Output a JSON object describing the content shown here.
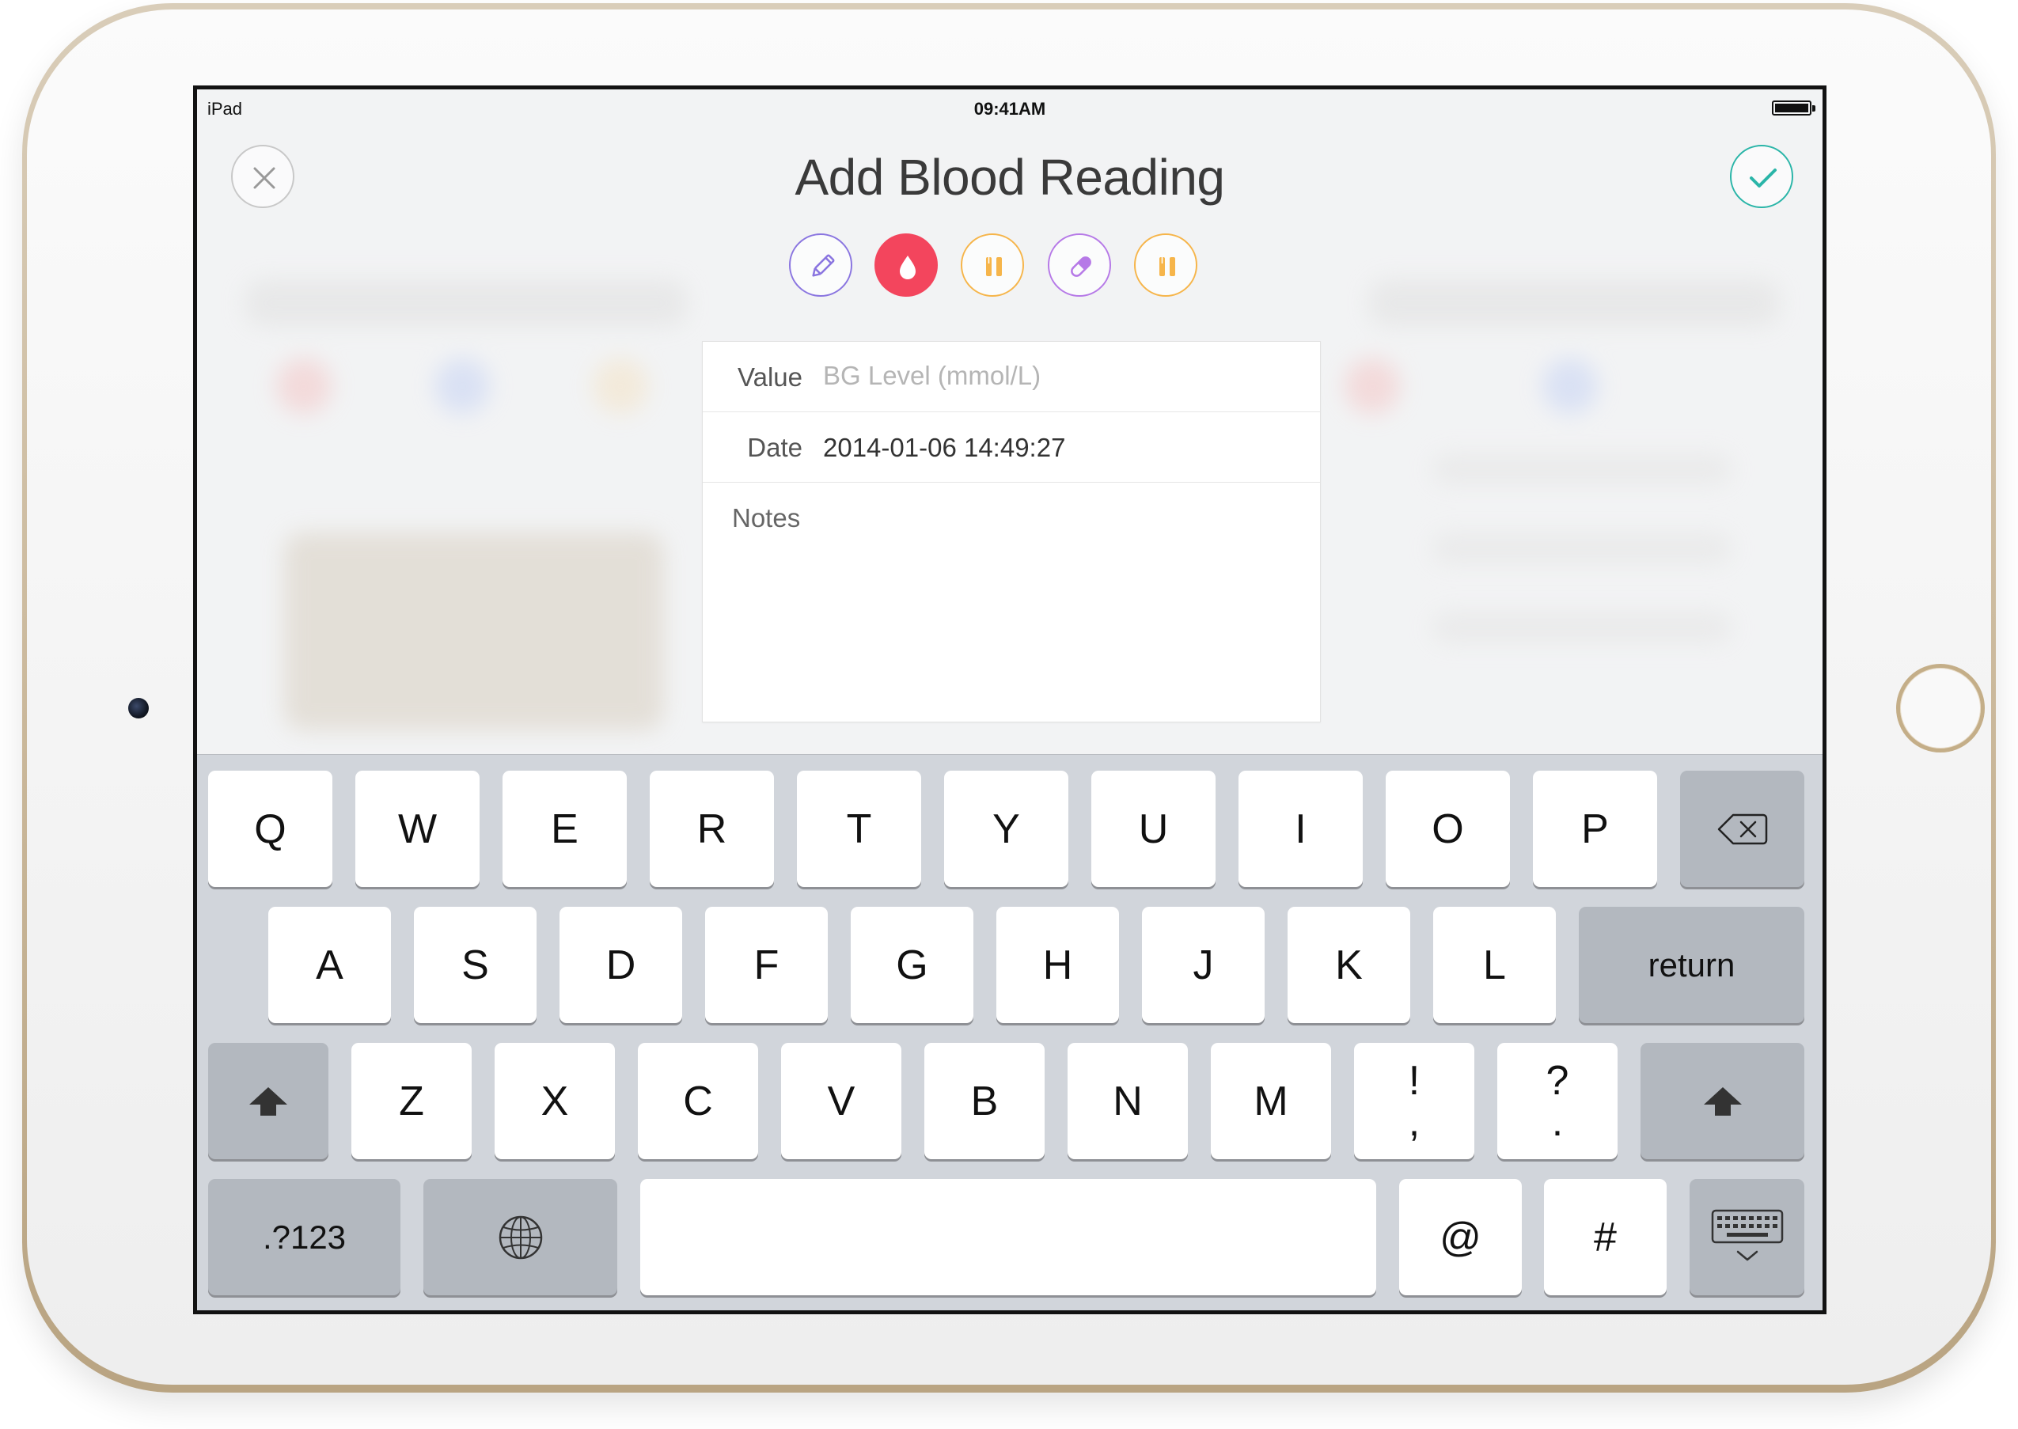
{
  "status_bar": {
    "device": "iPad",
    "time": "09:41AM",
    "battery_level": 1.0
  },
  "header": {
    "title": "Add Blood Reading",
    "close_icon": "close-icon",
    "confirm_icon": "checkmark-icon"
  },
  "entry_types": [
    {
      "id": "note",
      "icon": "pencil-icon",
      "color": "#8a75e0",
      "selected": false
    },
    {
      "id": "blood",
      "icon": "blood-drop-icon",
      "color": "#f3455d",
      "selected": true
    },
    {
      "id": "meal",
      "icon": "fork-knife-icon",
      "color": "#f6b54a",
      "selected": false
    },
    {
      "id": "medication",
      "icon": "pill-icon",
      "color": "#b679e7",
      "selected": false
    },
    {
      "id": "meal-2",
      "icon": "fork-knife-icon",
      "color": "#f6b54a",
      "selected": false
    }
  ],
  "form": {
    "value_label": "Value",
    "value_placeholder": "BG Level (mmol/L)",
    "value_input": "",
    "date_label": "Date",
    "date_value": "2014-01-06 14:49:27",
    "notes_label": "Notes",
    "notes_value": ""
  },
  "keyboard": {
    "row1": [
      "Q",
      "W",
      "E",
      "R",
      "T",
      "Y",
      "U",
      "I",
      "O",
      "P"
    ],
    "row2": [
      "A",
      "S",
      "D",
      "F",
      "G",
      "H",
      "J",
      "K",
      "L"
    ],
    "row3": [
      "Z",
      "X",
      "C",
      "V",
      "B",
      "N",
      "M"
    ],
    "punct1": [
      "!",
      ","
    ],
    "punct2": [
      "?",
      "."
    ],
    "return_label": "return",
    "numbers_label": ".?123",
    "at_label": "@",
    "hash_label": "#",
    "delete_icon": "backspace-icon",
    "shift_icon": "shift-icon",
    "globe_icon": "globe-icon",
    "dismiss_icon": "keyboard-dismiss-icon"
  },
  "colors": {
    "accent_teal": "#2ab5a8",
    "keyboard_bg": "#d1d5db",
    "dark_key": "#b3b8bf"
  }
}
